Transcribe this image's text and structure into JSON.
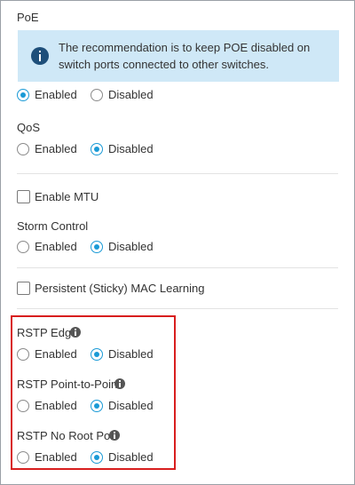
{
  "poe": {
    "title": "PoE",
    "banner_text": "The recommendation is to keep POE disabled on switch ports connected to other switches.",
    "enabled_label": "Enabled",
    "disabled_label": "Disabled",
    "selected": "Enabled"
  },
  "qos": {
    "title": "QoS",
    "enabled_label": "Enabled",
    "disabled_label": "Disabled",
    "selected": "Disabled"
  },
  "mtu": {
    "label": "Enable MTU",
    "checked": false
  },
  "storm_control": {
    "title": "Storm Control",
    "enabled_label": "Enabled",
    "disabled_label": "Disabled",
    "selected": "Disabled"
  },
  "mac_learning": {
    "label": "Persistent (Sticky) MAC Learning",
    "checked": false
  },
  "rstp_edge": {
    "title": "RSTP Edge",
    "icon": "info-icon",
    "enabled_label": "Enabled",
    "disabled_label": "Disabled",
    "selected": "Disabled"
  },
  "rstp_p2p": {
    "title": "RSTP Point-to-Point",
    "icon": "info-icon",
    "enabled_label": "Enabled",
    "disabled_label": "Disabled",
    "selected": "Disabled"
  },
  "rstp_no_root": {
    "title": "RSTP No Root Port",
    "icon": "info-icon",
    "enabled_label": "Enabled",
    "disabled_label": "Disabled",
    "selected": "Disabled"
  },
  "colors": {
    "accent": "#1a9ad6",
    "banner_bg": "#cfe8f7",
    "banner_icon": "#1e4f7a",
    "highlight": "#d81e1e"
  }
}
